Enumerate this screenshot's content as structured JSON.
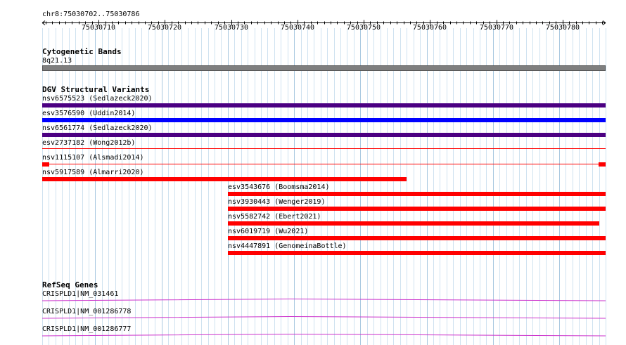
{
  "locus": {
    "label": "chr8:75030702..75030786",
    "start": 75030702,
    "end": 75030786
  },
  "ruler": {
    "major_ticks": [
      "75030710",
      "75030720",
      "75030730",
      "75030740",
      "75030750",
      "75030760",
      "75030770",
      "75030780"
    ]
  },
  "colors": {
    "grid_major": "#a8c8e0",
    "grid_minor": "#cfe2f0",
    "cytoband": "#7f7f7f",
    "sv_loss": "#ff0000",
    "sv_gain": "#0000ff",
    "sv_complex": "#4b0082",
    "gene": "#cc33cc"
  },
  "tracks": {
    "cytoband": {
      "title": "Cytogenetic Bands",
      "band": "8q21.13"
    },
    "dgv": {
      "title": "DGV Structural Variants",
      "variants": [
        {
          "id": "nsv6575523",
          "label": "nsv6575523 (Sedlazeck2020)",
          "start": 75030702,
          "end": 75030786,
          "type": "complex",
          "style": "bar"
        },
        {
          "id": "esv3576590",
          "label": "esv3576590 (Uddin2014)",
          "start": 75030702,
          "end": 75030786,
          "type": "gain",
          "style": "bar"
        },
        {
          "id": "nsv6561774",
          "label": "nsv6561774 (Sedlazeck2020)",
          "start": 75030702,
          "end": 75030786,
          "type": "complex",
          "style": "bar"
        },
        {
          "id": "esv2737182",
          "label": "esv2737182 (Wong2012b)",
          "start": 75030702,
          "end": 75030786,
          "type": "loss",
          "style": "line"
        },
        {
          "id": "nsv1115107",
          "label": "nsv1115107 (Alsmadi2014)",
          "start": 75030702,
          "end": 75030786,
          "type": "loss",
          "style": "split"
        },
        {
          "id": "nsv5917589",
          "label": "nsv5917589 (Almarri2020)",
          "start": 75030702,
          "end": 75030756,
          "type": "loss",
          "style": "bar"
        },
        {
          "id": "esv3543676",
          "label": "esv3543676 (Boomsma2014)",
          "start": 75030730,
          "end": 75030786,
          "type": "loss",
          "style": "bar"
        },
        {
          "id": "nsv3930443",
          "label": "nsv3930443 (Wenger2019)",
          "start": 75030730,
          "end": 75030786,
          "type": "loss",
          "style": "bar"
        },
        {
          "id": "nsv5582742",
          "label": "nsv5582742 (Ebert2021)",
          "start": 75030730,
          "end": 75030785,
          "type": "loss",
          "style": "bar"
        },
        {
          "id": "nsv6019719",
          "label": "nsv6019719 (Wu2021)",
          "start": 75030730,
          "end": 75030786,
          "type": "loss",
          "style": "bar"
        },
        {
          "id": "nsv4447891",
          "label": "nsv4447891 (GenomeinaBottle)",
          "start": 75030730,
          "end": 75030786,
          "type": "loss",
          "style": "bar"
        }
      ]
    },
    "refseq": {
      "title": "RefSeq Genes",
      "genes": [
        {
          "label": "CRISPLD1|NM_031461"
        },
        {
          "label": "CRISPLD1|NM_001286778"
        },
        {
          "label": "CRISPLD1|NM_001286777"
        }
      ]
    }
  }
}
